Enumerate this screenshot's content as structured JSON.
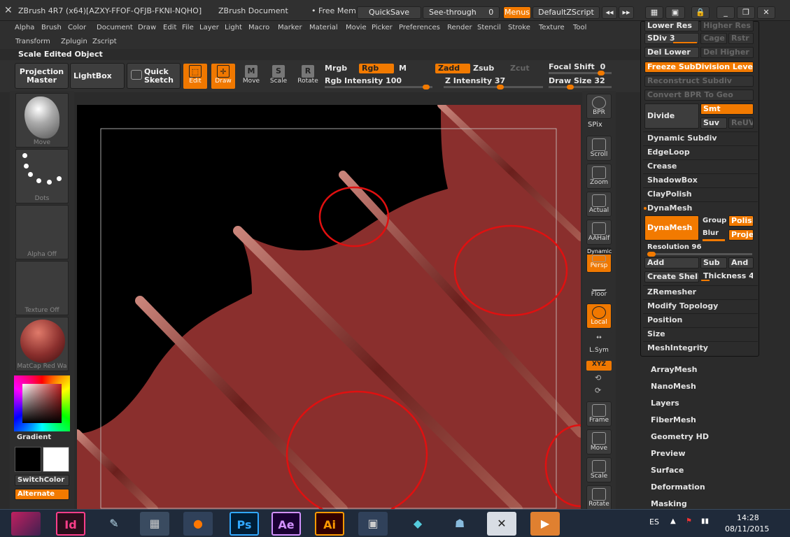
{
  "title": {
    "app": "ZBrush 4R7 (x64)[AZXY-FFOF-QFJB-FKNI-NQHO]",
    "document": "ZBrush Document",
    "free_mem": "• Free Mem",
    "quicksave": "QuickSave",
    "see_through": "See-through",
    "see_through_value": "0",
    "menus": "Menus",
    "default_zscript": "DefaultZScript"
  },
  "menus": [
    "Alpha",
    "Brush",
    "Color",
    "Document",
    "Draw",
    "Edit",
    "File",
    "Layer",
    "Light",
    "Macro",
    "Marker",
    "Material",
    "Movie",
    "Picker",
    "Preferences",
    "Render",
    "Stencil",
    "Stroke",
    "Texture",
    "Tool",
    "Transform",
    "Zplugin",
    "Zscript"
  ],
  "subtitle": "Scale Edited Object",
  "toolbar": {
    "projection_master": "Projection Master",
    "lightbox": "LightBox",
    "quick_sketch": "Quick Sketch",
    "edit": "Edit",
    "draw": "Draw",
    "move": "Move",
    "scale": "Scale",
    "rotate": "Rotate",
    "mrgb": "Mrgb",
    "rgb": "Rgb",
    "m": "M",
    "zadd": "Zadd",
    "zsub": "Zsub",
    "zcut": "Zcut",
    "rgb_intensity": "Rgb Intensity 100",
    "z_intensity": "Z Intensity 37",
    "focal_shift": "Focal Shift",
    "focal_shift_value": "0",
    "draw_size": "Draw Size 32"
  },
  "left_shelf": {
    "move": "Move",
    "dots": "Dots",
    "alpha_off": "Alpha Off",
    "texture_off": "Texture Off",
    "matcap": "MatCap Red Wa",
    "gradient": "Gradient",
    "switch_color": "SwitchColor",
    "alternate": "Alternate"
  },
  "right_shelf": {
    "bpr": "BPR",
    "spix": "SPix",
    "scroll": "Scroll",
    "zoom": "Zoom",
    "actual": "Actual",
    "aahalf": "AAHalf",
    "dynamic": "Dynamic",
    "persp": "Persp",
    "floor": "Floor",
    "local": "Local",
    "lsym": "L.Sym",
    "xyz": "XYZ",
    "frame": "Frame",
    "move": "Move",
    "scale": "Scale",
    "rotate": "Rotate"
  },
  "geometry": {
    "lower_res": "Lower Res",
    "higher_res": "Higher Res",
    "sdiv": "SDiv 3",
    "cage": "Cage",
    "rstr": "Rstr",
    "del_lower": "Del Lower",
    "del_higher": "Del Higher",
    "freeze": "Freeze SubDivision Levels",
    "reconstruct": "Reconstruct Subdiv",
    "convert_bpr": "Convert BPR To Geo",
    "divide": "Divide",
    "smt": "Smt",
    "suv": "Suv",
    "reuv": "ReUV",
    "dynamic_subdiv": "Dynamic Subdiv",
    "edgeloop": "EdgeLoop",
    "crease": "Crease",
    "shadowbox": "ShadowBox",
    "claypolish": "ClayPolish",
    "dynamesh_header": "DynaMesh",
    "dynamesh_btn": "DynaMesh",
    "group": "Group",
    "polish": "Polish",
    "blur": "Blur",
    "project": "Project",
    "resolution": "Resolution 96",
    "add": "Add",
    "sub": "Sub",
    "and": "And",
    "create_shell": "Create Shell",
    "thickness": "Thickness 4",
    "zremesher": "ZRemesher",
    "modify_topology": "Modify Topology",
    "position": "Position",
    "size": "Size",
    "meshintegrity": "MeshIntegrity"
  },
  "tool_list": [
    "ArrayMesh",
    "NanoMesh",
    "Layers",
    "FiberMesh",
    "Geometry HD",
    "Preview",
    "Surface",
    "Deformation",
    "Masking"
  ],
  "taskbar": {
    "lang": "ES",
    "time": "14:28",
    "date": "08/11/2015"
  },
  "colors": {
    "accent": "#f27a00",
    "surface": "#8a2f2d",
    "annotation": "#e01010"
  }
}
